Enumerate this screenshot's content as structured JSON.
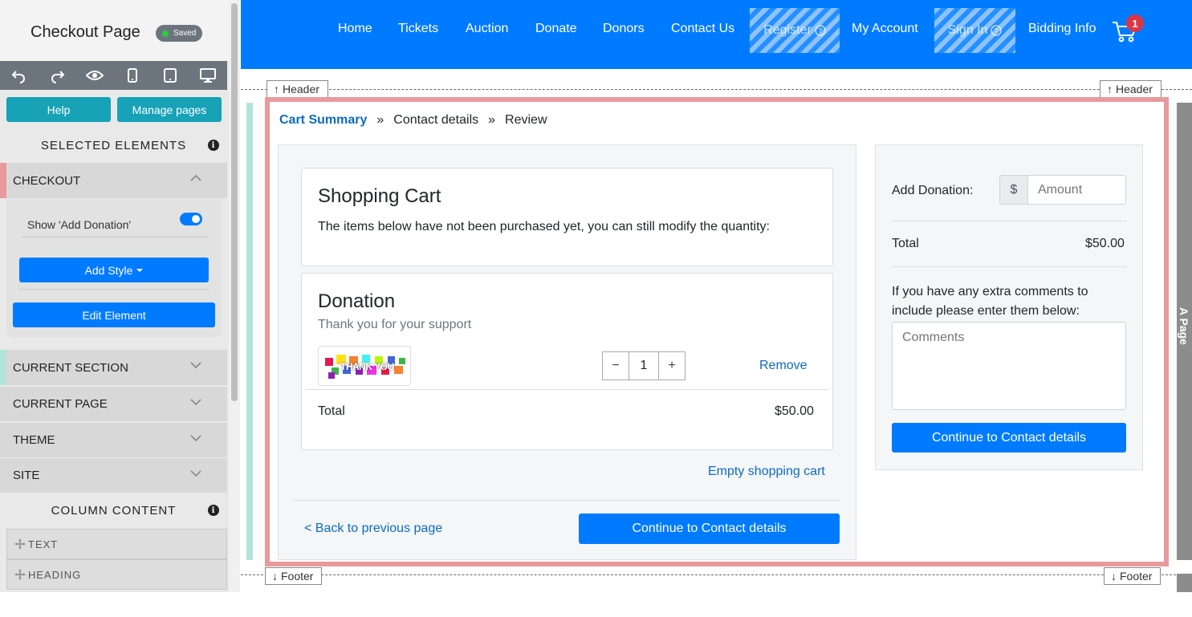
{
  "sidebar": {
    "title": "Checkout Page",
    "saved_label": "Saved",
    "help_label": "Help",
    "manage_pages_label": "Manage pages",
    "selected_heading": "SELECTED ELEMENTS",
    "checkout_label": "CHECKOUT",
    "show_add_donation_label": "Show 'Add Donation'",
    "add_style_label": "Add Style",
    "edit_element_label": "Edit Element",
    "current_section_label": "CURRENT SECTION",
    "current_page_label": "CURRENT PAGE",
    "theme_label": "THEME",
    "site_label": "SITE",
    "column_content_heading": "COLUMN CONTENT",
    "drag_items": [
      "TEXT",
      "HEADING"
    ]
  },
  "nav": {
    "items": [
      "Home",
      "Tickets",
      "Auction",
      "Donate",
      "Donors",
      "Contact Us"
    ],
    "register_label": "Register",
    "my_account_label": "My Account",
    "sign_in_label": "Sign In",
    "bidding_info_label": "Bidding Info",
    "cart_count": "1"
  },
  "markers": {
    "header": "Header",
    "footer": "Footer",
    "page_strip": "A Page"
  },
  "breadcrumb": {
    "step1": "Cart Summary",
    "sep": "»",
    "step2": "Contact details",
    "step3": "Review"
  },
  "cart": {
    "heading": "Shopping Cart",
    "intro": "The items below have not been purchased yet, you can still modify the quantity:",
    "item_title": "Donation",
    "item_subtitle": "Thank you for your support",
    "image_text": "THANK YOU",
    "quantity": "1",
    "remove_label": "Remove",
    "total_label": "Total",
    "total_value": "$50.00",
    "empty_cart_label": "Empty shopping cart",
    "back_label": "< Back to previous page",
    "continue_label": "Continue to Contact details"
  },
  "summary": {
    "add_donation_label": "Add Donation:",
    "currency": "$",
    "amount_placeholder": "Amount",
    "total_label": "Total",
    "total_value": "$50.00",
    "comments_prompt": "If you have any extra comments to include please enter them below:",
    "comments_placeholder": "Comments",
    "continue_label": "Continue to Contact details"
  },
  "colors": {
    "brand_blue": "#007bff",
    "teal": "#17a2b8",
    "selection_frame": "#e8999c"
  }
}
